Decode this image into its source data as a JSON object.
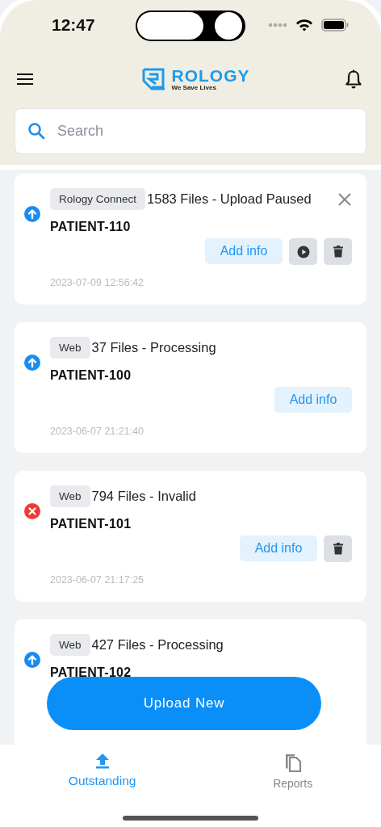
{
  "status_bar": {
    "time": "12:47"
  },
  "header": {
    "logo_name": "ROLOGY",
    "logo_tagline": "We Save Lives"
  },
  "search": {
    "placeholder": "Search"
  },
  "uploads": [
    {
      "kind": "uploading",
      "source": "Rology Connect",
      "summary": "1583 Files - Upload Paused",
      "patient": "PATIENT-110",
      "button": "Add info",
      "controls": [
        {
          "kind": "close"
        },
        {
          "kind": "play"
        },
        {
          "kind": "delete"
        }
      ],
      "date": "2023-07-09 12:56:42"
    },
    {
      "kind": "uploading",
      "source": "Web",
      "summary": "37 Files - Processing",
      "patient": "PATIENT-100",
      "button": "Add info",
      "date": "2023-06-07 21:21:40"
    },
    {
      "kind": "error",
      "source": "Web",
      "summary": "794 Files - Invalid",
      "patient": "PATIENT-101",
      "button": "Add info",
      "controls": [
        {
          "kind": "delete"
        }
      ],
      "date": "2023-06-07 21:17:25"
    },
    {
      "kind": "uploading",
      "source": "Web",
      "summary": "427 Files - Processing",
      "patient": "PATIENT-102"
    }
  ],
  "upload_button": "Upload New",
  "tabs": [
    {
      "label": "Outstanding",
      "selected": true
    },
    {
      "label": "Reports",
      "selected": false
    }
  ]
}
